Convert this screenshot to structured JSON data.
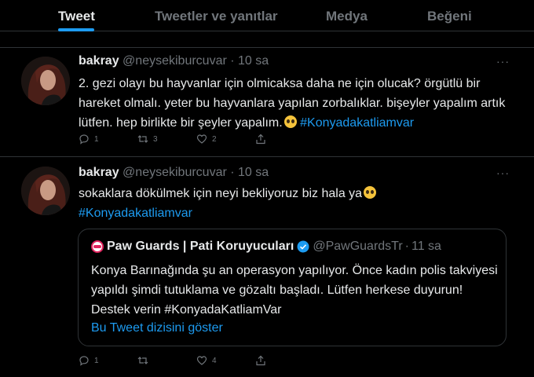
{
  "tabs": {
    "items": [
      {
        "label": "Tweet"
      },
      {
        "label": "Tweetler ve yanıtlar"
      },
      {
        "label": "Medya"
      },
      {
        "label": "Beğeni"
      }
    ],
    "active": "Tweet",
    "accent_color": "#1d9bf0"
  },
  "tweets": [
    {
      "display_name": "bakray",
      "handle": "@neysekiburcuvar",
      "separator": "·",
      "time": "10 sa",
      "text": "2. gezi olayı bu hayvanlar için olmicaksa daha ne için olucak? örgütlü bir hareket olmalı. yeter bu hayvanlara yapılan zorbalıklar. bişeyler yapalım artık lütfen. hep birlikte bir şeyler yapalım.",
      "hashtag": "#Konyadakatliamvar",
      "reply_count": "1",
      "retweet_count": "3",
      "like_count": "2"
    },
    {
      "display_name": "bakray",
      "handle": "@neysekiburcuvar",
      "separator": "·",
      "time": "10 sa",
      "text": "sokaklara dökülmek için neyi bekliyoruz biz hala ya",
      "hashtag": "#Konyadakatliamvar",
      "reply_count": "1",
      "retweet_count": "",
      "like_count": "4",
      "quote": {
        "display_name": "Paw Guards | Pati Koruyucuları",
        "handle": "@PawGuardsTr",
        "separator": "·",
        "time": "11 sa",
        "text": "Konya Barınağında şu an operasyon yapılıyor. Önce kadın polis takviyesi yapıldı şimdi tutuklama ve gözaltı başladı. Lütfen herkese duyurun! Destek verin #KonyadaKatliamVar",
        "show_thread_label": "Bu Tweet dizisini göster"
      }
    }
  ],
  "icons": [
    "reply-icon",
    "retweet-icon",
    "like-icon",
    "share-icon",
    "more-icon",
    "verified-icon",
    "emoji-pleading-icon"
  ]
}
